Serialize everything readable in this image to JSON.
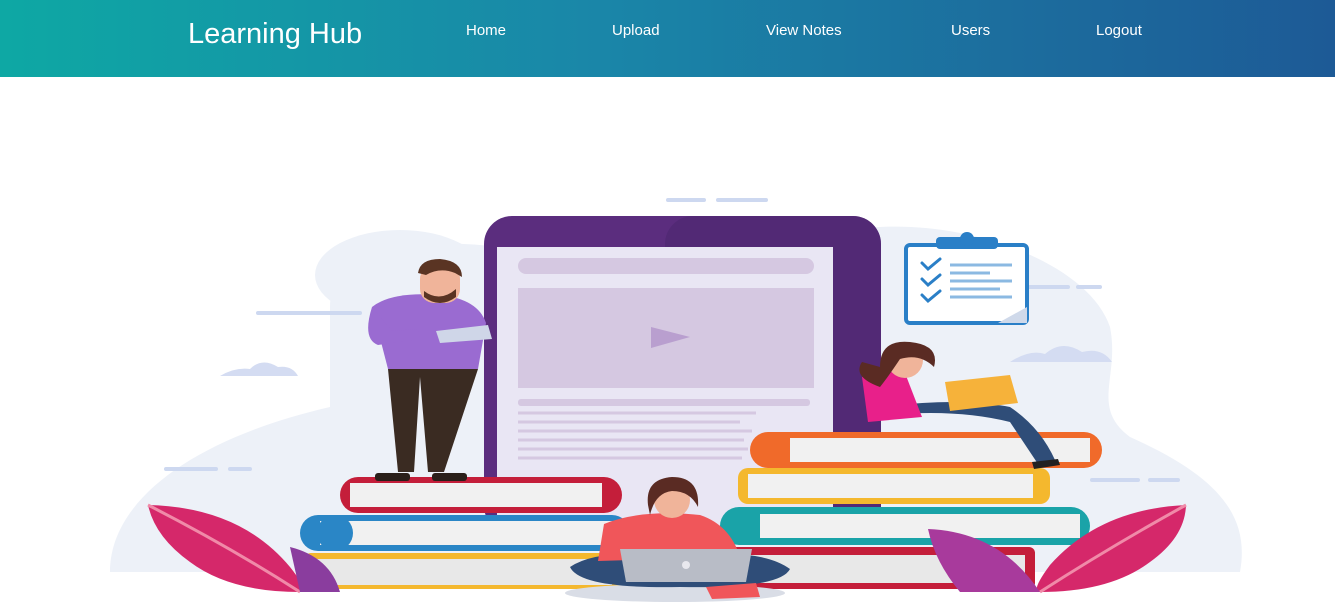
{
  "navbar": {
    "brand": "Learning Hub",
    "links": [
      {
        "label": "Home"
      },
      {
        "label": "Upload"
      },
      {
        "label": "View Notes"
      },
      {
        "label": "Users"
      },
      {
        "label": "Logout"
      }
    ],
    "gradient_start": "#0ea8a4",
    "gradient_end": "#1d5a96"
  },
  "hero": {
    "illustration": "people-studying-with-books-and-tablet-illustration",
    "palette": {
      "tablet": "#5b2d7e",
      "screen": "#e9e6f4",
      "book_red": "#c41e3a",
      "book_blue": "#2a86c6",
      "book_orange": "#f06a2a",
      "book_yellow": "#f4b82e",
      "book_teal": "#1aa3a8",
      "leaf_pink": "#d5286a",
      "blob": "#edf1f8"
    }
  }
}
